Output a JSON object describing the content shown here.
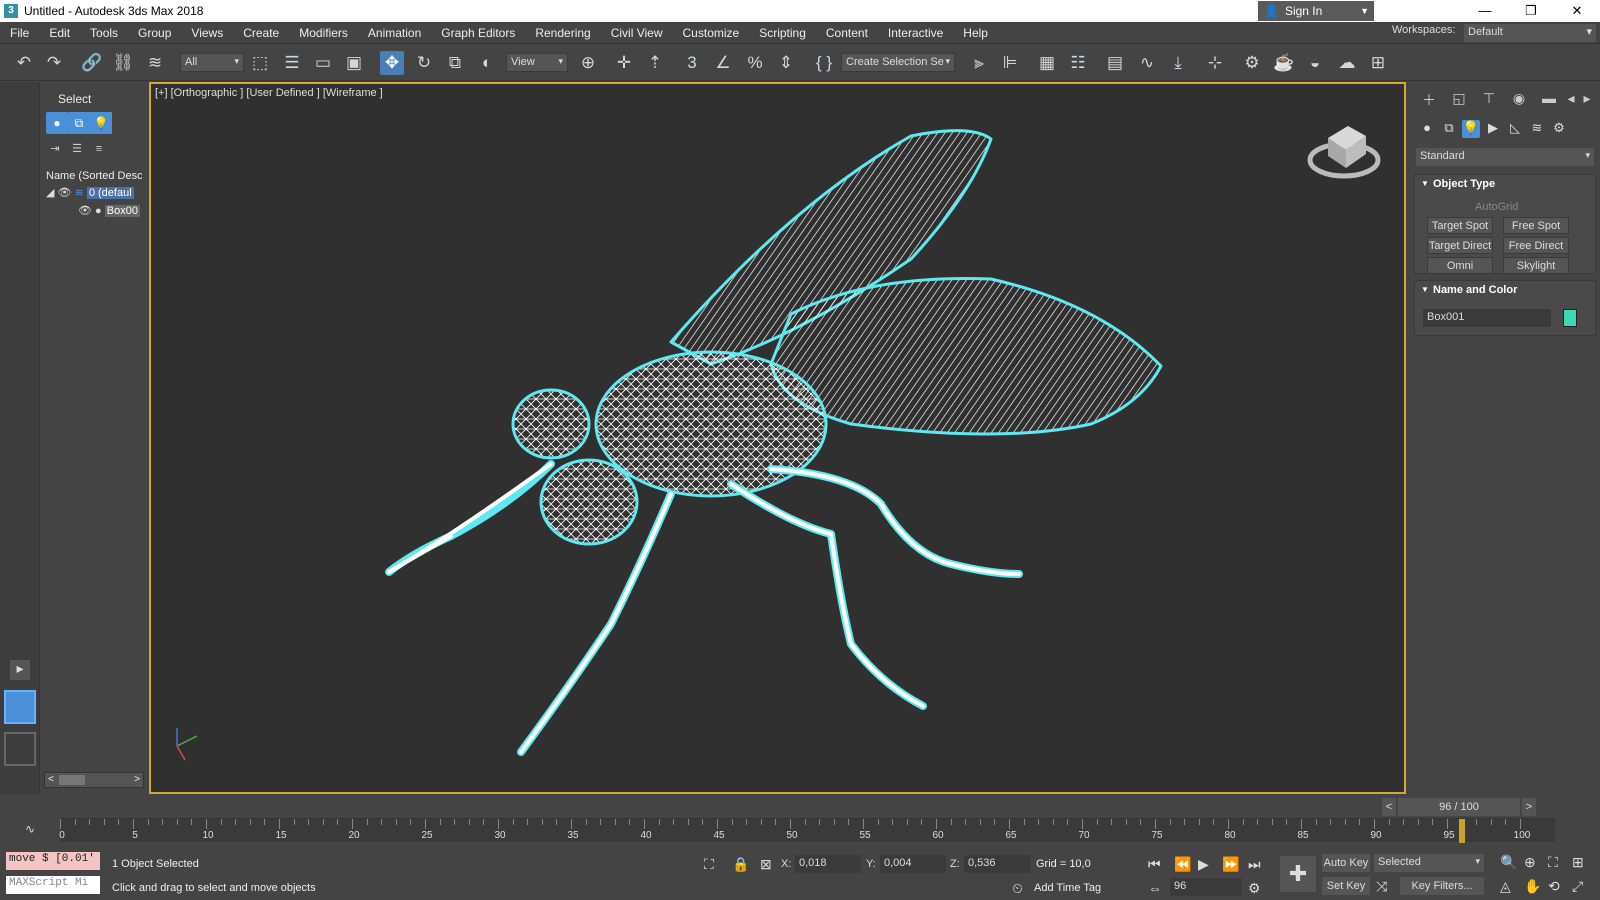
{
  "titlebar": {
    "title": "Untitled - Autodesk 3ds Max 2018",
    "app_icon": "3"
  },
  "menu": [
    "File",
    "Edit",
    "Tools",
    "Group",
    "Views",
    "Create",
    "Modifiers",
    "Animation",
    "Graph Editors",
    "Rendering",
    "Civil View",
    "Customize",
    "Scripting",
    "Content",
    "Interactive",
    "Help"
  ],
  "signin": {
    "label": "Sign In"
  },
  "workspaces": {
    "label": "Workspaces:",
    "value": "Default"
  },
  "toolbar": {
    "filter": "All",
    "refcoord": "View",
    "selection_set": "Create Selection Se"
  },
  "explorer": {
    "header": "Select",
    "name_column": "Name (Sorted Desce",
    "layer": "0 (defaul",
    "object": "Box00"
  },
  "viewport": {
    "label": "[+] [Orthographic ] [User Defined ] [Wireframe ]",
    "wire_color": "#5ee8f0"
  },
  "command_panel": {
    "category": "Standard",
    "object_type": {
      "title": "Object Type",
      "autogrid": "AutoGrid",
      "buttons": [
        "Target Spot",
        "Free Spot",
        "Target Direct",
        "Free Direct",
        "Omni",
        "Skylight"
      ]
    },
    "name_color": {
      "title": "Name and Color",
      "name": "Box001",
      "color": "#3ed8b4"
    }
  },
  "timeline": {
    "frame": "96 / 100",
    "current": 96,
    "max": 100,
    "labels": [
      "0",
      "5",
      "10",
      "15",
      "20",
      "25",
      "30",
      "35",
      "40",
      "45",
      "50",
      "55",
      "60",
      "65",
      "70",
      "75",
      "80",
      "85",
      "90",
      "95",
      "100"
    ]
  },
  "status": {
    "maxscript1": "move $ [0.01'",
    "maxscript2": "MAXScript Mi",
    "selected": "1 Object Selected",
    "prompt": "Click and drag to select and move objects",
    "x_label": "X:",
    "x": "0,018",
    "y_label": "Y:",
    "y": "0,004",
    "z_label": "Z:",
    "z": "0,536",
    "grid": "Grid = 10,0",
    "add_time_tag": "Add Time Tag",
    "auto_key": "Auto Key",
    "set_key": "Set Key",
    "selected_mode": "Selected",
    "key_filters": "Key Filters...",
    "frame_field": "96"
  }
}
